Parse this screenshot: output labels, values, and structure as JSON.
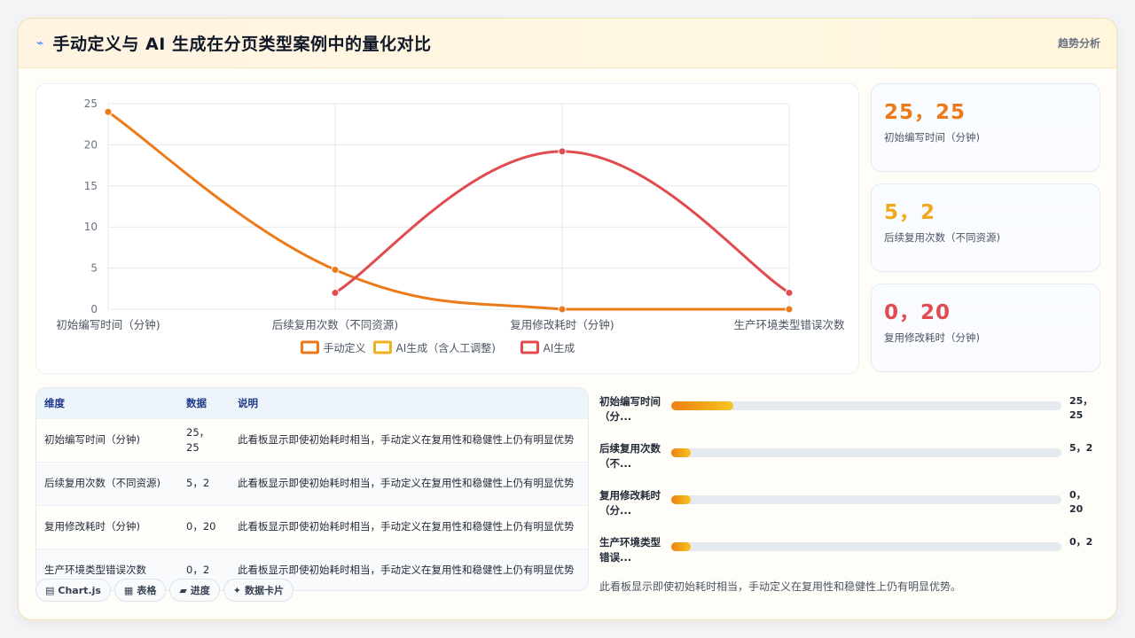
{
  "header": {
    "icon": "sparkle-icon",
    "title": "手动定义与 AI 生成在分页类型案例中的量化对比",
    "tag": "趋势分析"
  },
  "colors": {
    "manual": "#ec7a18",
    "ai_assisted": "#f0b11f",
    "ai": "#e14a4f",
    "stat1": "#ec7a18",
    "stat2": "#f0a81c",
    "stat3": "#e14a4f"
  },
  "chart_data": {
    "type": "line",
    "categories": [
      "初始编写时间（分钟)",
      "后续复用次数（不同资源)",
      "复用修改耗时（分钟)",
      "生产环境类型错误次数"
    ],
    "ylim": [
      0,
      25
    ],
    "yticks": [
      0,
      5,
      10,
      15,
      20,
      25
    ],
    "grid": true,
    "legend_position": "bottom",
    "series": [
      {
        "name": "手动定义",
        "values": [
          24,
          4.8,
          0,
          0
        ]
      },
      {
        "name": "AI生成（含人工调整)",
        "values": [
          null,
          null,
          null,
          null
        ]
      },
      {
        "name": "AI生成",
        "values": [
          null,
          2,
          19.2,
          2
        ]
      }
    ]
  },
  "stats": [
    {
      "value": "25，25",
      "label": "初始编写时间（分钟)"
    },
    {
      "value": "5，2",
      "label": "后续复用次数（不同资源)"
    },
    {
      "value": "0，20",
      "label": "复用修改耗时（分钟)"
    }
  ],
  "table": {
    "headers": [
      "维度",
      "数据",
      "说明"
    ],
    "rows": [
      {
        "dim": "初始编写时间（分钟)",
        "data": "25，25",
        "desc": "此看板显示即使初始耗时相当，手动定义在复用性和稳健性上仍有明显优势"
      },
      {
        "dim": "后续复用次数（不同资源)",
        "data": "5，2",
        "desc": "此看板显示即使初始耗时相当，手动定义在复用性和稳健性上仍有明显优势"
      },
      {
        "dim": "复用修改耗时（分钟)",
        "data": "0，20",
        "desc": "此看板显示即使初始耗时相当，手动定义在复用性和稳健性上仍有明显优势"
      },
      {
        "dim": "生产环境类型错误次数",
        "data": "0，2",
        "desc": "此看板显示即使初始耗时相当，手动定义在复用性和稳健性上仍有明显优势"
      }
    ]
  },
  "chips": [
    {
      "icon": "chart-icon",
      "glyph": "▤",
      "label": "Chart.js"
    },
    {
      "icon": "table-icon",
      "glyph": "▦",
      "label": "表格"
    },
    {
      "icon": "progress-icon",
      "glyph": "▰",
      "label": "进度"
    },
    {
      "icon": "sparkle-icon",
      "glyph": "✦",
      "label": "数据卡片"
    }
  ],
  "progress": [
    {
      "label": "初始编写时间（分...",
      "value": "25，25",
      "fraction": 0.16
    },
    {
      "label": "后续复用次数（不...",
      "value": "5，2",
      "fraction": 0.05
    },
    {
      "label": "复用修改耗时（分...",
      "value": "0，20",
      "fraction": 0.05
    },
    {
      "label": "生产环境类型错误...",
      "value": "0，2",
      "fraction": 0.05
    }
  ],
  "note": "此看板显示即使初始耗时相当，手动定义在复用性和稳健性上仍有明显优势。"
}
